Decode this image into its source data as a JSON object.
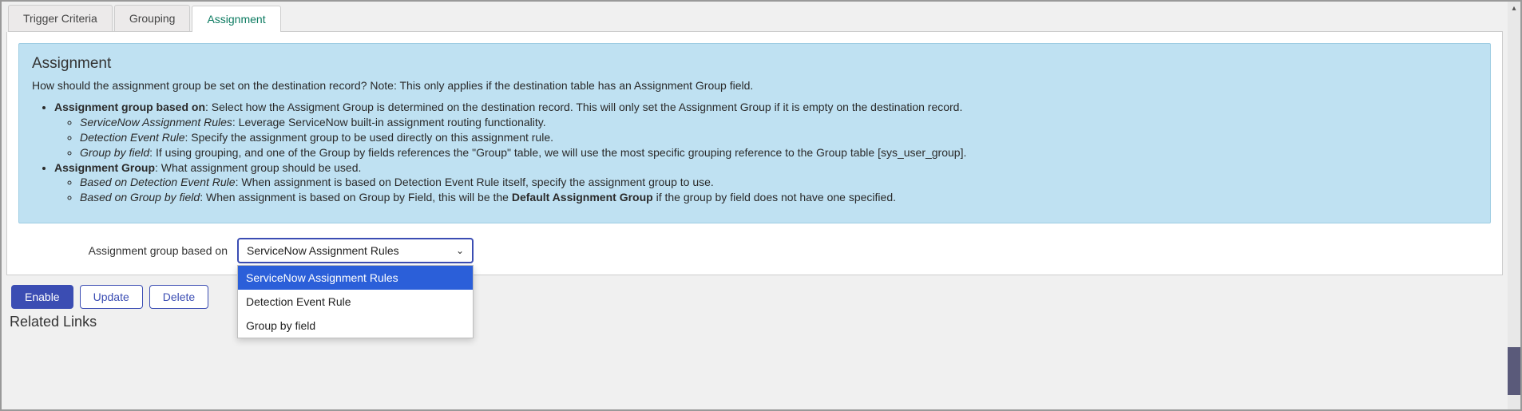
{
  "tabs": {
    "trigger": "Trigger Criteria",
    "grouping": "Grouping",
    "assignment": "Assignment"
  },
  "info": {
    "title": "Assignment",
    "description": "How should the assignment group be set on the destination record? Note: This only applies if the destination table has an Assignment Group field.",
    "item1_bold": "Assignment group based on",
    "item1_text": ": Select how the Assigment Group is determined on the destination record. This will only set the Assignment Group if it is empty on the destination record.",
    "item1a_italic": "ServiceNow Assignment Rules",
    "item1a_text": ": Leverage ServiceNow built-in assignment routing functionality.",
    "item1b_italic": "Detection Event Rule",
    "item1b_text": ": Specify the assignment group to be used directly on this assignment rule.",
    "item1c_italic": "Group by field",
    "item1c_text": ": If using grouping, and one of the Group by fields references the \"Group\" table, we will use the most specific grouping reference to the Group table [sys_user_group].",
    "item2_bold": "Assignment Group",
    "item2_text": ": What assignment group should be used.",
    "item2a_italic": "Based on Detection Event Rule",
    "item2a_text": ": When assignment is based on Detection Event Rule itself, specify the assignment group to use.",
    "item2b_italic": "Based on Group by field",
    "item2b_text_pre": ": When assignment is based on Group by Field, this will be the ",
    "item2b_bold": "Default Assignment Group",
    "item2b_text_post": " if the group by field does not have one specified."
  },
  "form": {
    "label": "Assignment group based on",
    "selected": "ServiceNow Assignment Rules",
    "options": {
      "o1": "ServiceNow Assignment Rules",
      "o2": "Detection Event Rule",
      "o3": "Group by field"
    }
  },
  "buttons": {
    "enable": "Enable",
    "update": "Update",
    "delete": "Delete"
  },
  "section": {
    "related": "Related Links"
  },
  "colors": {
    "primary": "#3b4db3",
    "info_bg": "#bfe1f2",
    "tab_active": "#0b7a60"
  }
}
